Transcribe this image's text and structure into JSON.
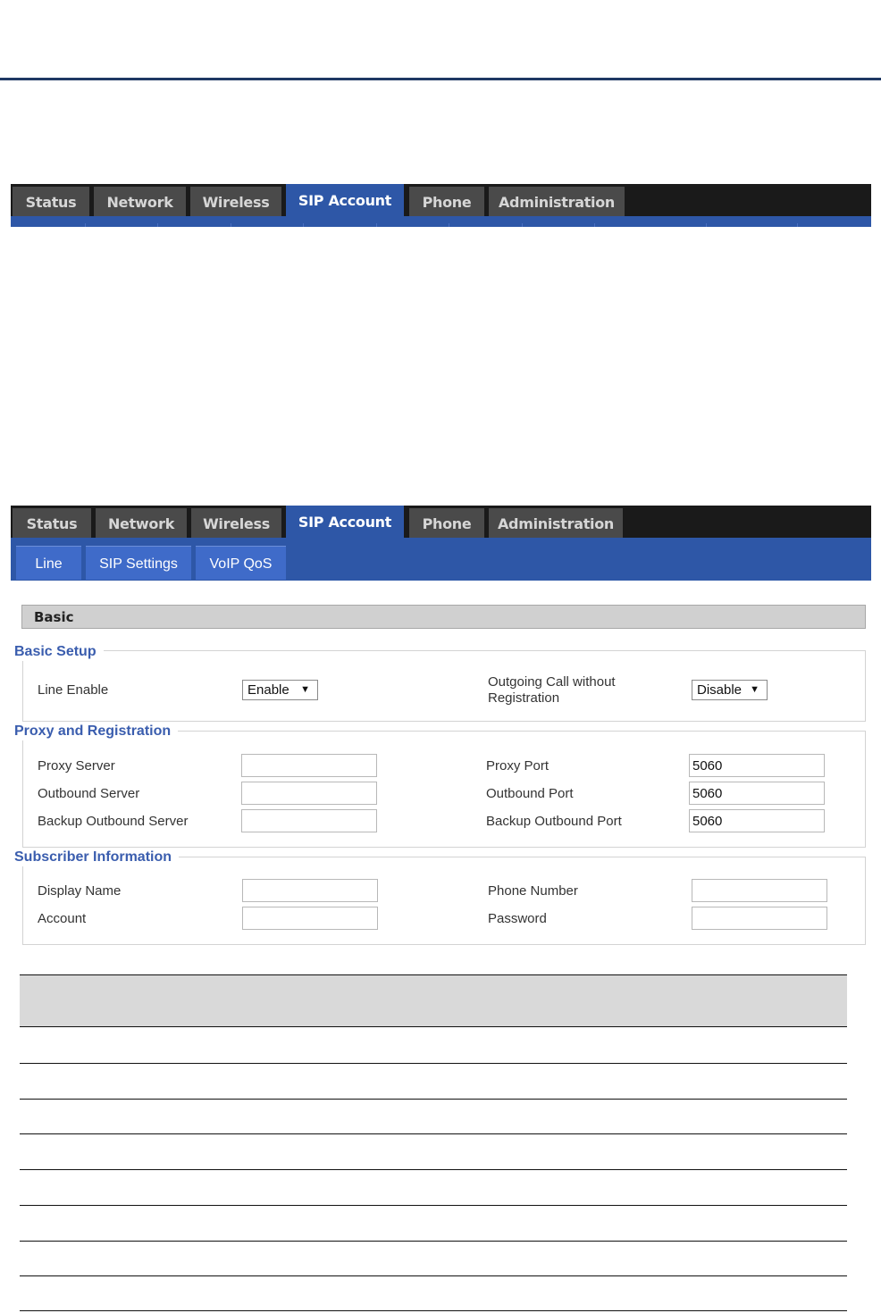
{
  "nav_top": {
    "tabs": [
      "Status",
      "Network",
      "Wireless",
      "SIP Account",
      "Phone",
      "Administration"
    ],
    "active": "SIP Account"
  },
  "nav_main": {
    "tabs": [
      "Status",
      "Network",
      "Wireless",
      "SIP Account",
      "Phone",
      "Administration"
    ],
    "active": "SIP Account",
    "subtabs": [
      "Line",
      "SIP Settings",
      "VoIP QoS"
    ],
    "active_subtab": "Line"
  },
  "section_title": "Basic",
  "basic_setup": {
    "legend": "Basic Setup",
    "line_enable_label": "Line Enable",
    "line_enable_value": "Enable",
    "outgoing_label_1": "Outgoing Call without",
    "outgoing_label_2": "Registration",
    "outgoing_value": "Disable"
  },
  "proxy": {
    "legend": "Proxy and Registration",
    "proxy_server_label": "Proxy Server",
    "proxy_server_value": "",
    "outbound_server_label": "Outbound Server",
    "outbound_server_value": "",
    "backup_outbound_server_label": "Backup Outbound Server",
    "backup_outbound_server_value": "",
    "proxy_port_label": "Proxy Port",
    "proxy_port_value": "5060",
    "outbound_port_label": "Outbound Port",
    "outbound_port_value": "5060",
    "backup_outbound_port_label": "Backup Outbound Port",
    "backup_outbound_port_value": "5060"
  },
  "subscriber": {
    "legend": "Subscriber Information",
    "display_name_label": "Display Name",
    "display_name_value": "",
    "account_label": "Account",
    "account_value": "",
    "phone_number_label": "Phone Number",
    "phone_number_value": "",
    "password_label": "Password",
    "password_value": ""
  },
  "colors": {
    "tab_active": "#2e57a7",
    "tab_inactive": "#4a4a4a",
    "tab_bar": "#1a1a1a",
    "legend_text": "#3a5dae",
    "header_rule": "#1f3864"
  }
}
